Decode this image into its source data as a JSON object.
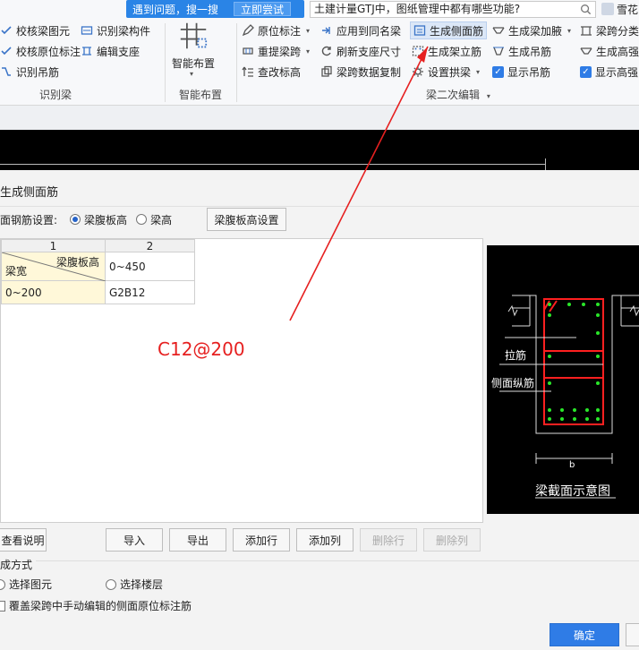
{
  "search": {
    "tip": "遇到问题，搜一搜",
    "try_button": "立即尝试",
    "query": "土建计量GTJ中，图纸管理中都有哪些功能?",
    "user": "雪花"
  },
  "ribbon": {
    "recognize_beam": {
      "items": [
        "校核梁图元",
        "校核原位标注",
        "识别吊筋",
        "识别梁构件",
        "编辑支座"
      ],
      "label": "识别梁"
    },
    "smart_layout": {
      "big_button": "智能布置",
      "label": "智能布置"
    },
    "secondary_edit": {
      "items": [
        "原位标注",
        "重提梁跨",
        "查改标高",
        "应用到同名梁",
        "刷新支座尺寸",
        "梁跨数据复制",
        "生成侧面筋",
        "生成架立筋",
        "设置拱梁",
        "生成梁加腋",
        "生成吊筋",
        "显示吊筋",
        "梁跨分类",
        "生成高强",
        "显示高强"
      ],
      "label": "梁二次编辑"
    }
  },
  "dialog": {
    "title": "生成侧面筋",
    "setting_label": "面钢筋设置:",
    "radio_web_height": "梁腹板高",
    "radio_beam_height": "梁高",
    "web_height_setting_button": "梁腹板高设置",
    "table": {
      "col_headers": [
        "1",
        "2"
      ],
      "corner_top": "梁腹板高",
      "corner_bottom": "梁宽",
      "range_header": "0~450",
      "row_label": "0~200",
      "row_value": "G2B12"
    },
    "preview": {
      "tie_label": "拉筋",
      "side_label": "侧面纵筋",
      "b_label": "b",
      "caption": "梁截面示意图"
    },
    "buttons": {
      "help": "查看说明",
      "import": "导入",
      "export": "导出",
      "add_row": "添加行",
      "add_col": "添加列",
      "delete_row": "删除行",
      "delete_col": "删除列"
    },
    "generate": {
      "label": "成方式",
      "select_element": "选择图元",
      "select_floor": "选择楼层",
      "override_check": "覆盖梁跨中手动编辑的侧面原位标注筋"
    },
    "ok": "确定"
  },
  "annotation": "C12@200",
  "colors": {
    "accent": "#2f7ce6",
    "annotation": "#e62020",
    "rebar_red": "#ff2020",
    "rebar_dot": "#29e629"
  }
}
